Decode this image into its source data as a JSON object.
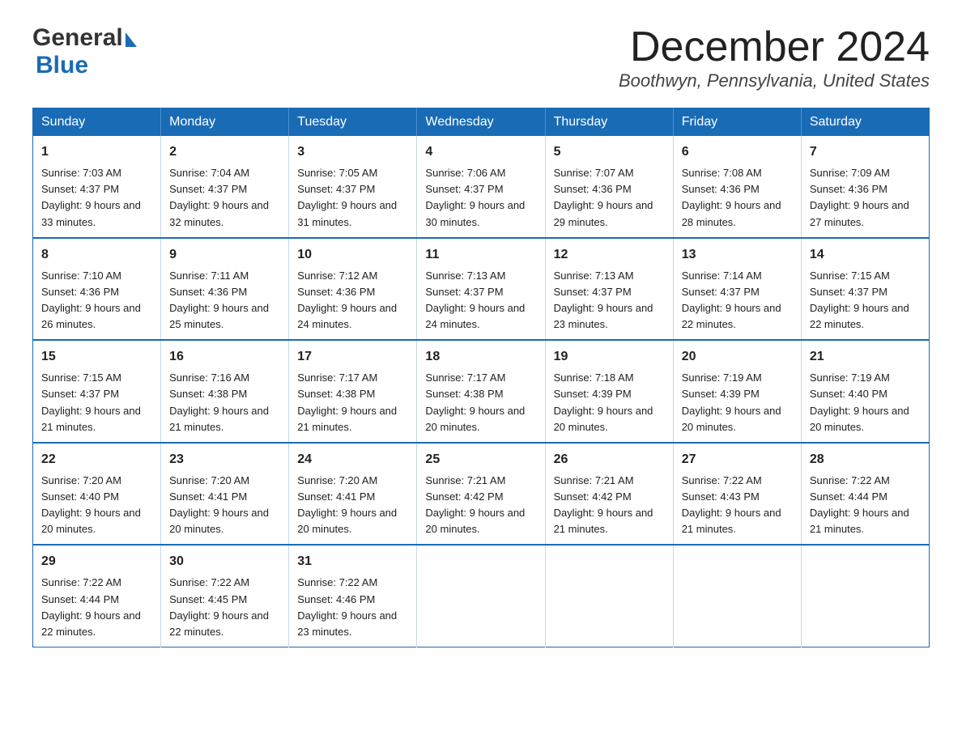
{
  "header": {
    "logo_general": "General",
    "logo_blue": "Blue",
    "month_title": "December 2024",
    "location": "Boothwyn, Pennsylvania, United States"
  },
  "days_of_week": [
    "Sunday",
    "Monday",
    "Tuesday",
    "Wednesday",
    "Thursday",
    "Friday",
    "Saturday"
  ],
  "weeks": [
    [
      {
        "day": "1",
        "sunrise": "7:03 AM",
        "sunset": "4:37 PM",
        "daylight": "9 hours and 33 minutes."
      },
      {
        "day": "2",
        "sunrise": "7:04 AM",
        "sunset": "4:37 PM",
        "daylight": "9 hours and 32 minutes."
      },
      {
        "day": "3",
        "sunrise": "7:05 AM",
        "sunset": "4:37 PM",
        "daylight": "9 hours and 31 minutes."
      },
      {
        "day": "4",
        "sunrise": "7:06 AM",
        "sunset": "4:37 PM",
        "daylight": "9 hours and 30 minutes."
      },
      {
        "day": "5",
        "sunrise": "7:07 AM",
        "sunset": "4:36 PM",
        "daylight": "9 hours and 29 minutes."
      },
      {
        "day": "6",
        "sunrise": "7:08 AM",
        "sunset": "4:36 PM",
        "daylight": "9 hours and 28 minutes."
      },
      {
        "day": "7",
        "sunrise": "7:09 AM",
        "sunset": "4:36 PM",
        "daylight": "9 hours and 27 minutes."
      }
    ],
    [
      {
        "day": "8",
        "sunrise": "7:10 AM",
        "sunset": "4:36 PM",
        "daylight": "9 hours and 26 minutes."
      },
      {
        "day": "9",
        "sunrise": "7:11 AM",
        "sunset": "4:36 PM",
        "daylight": "9 hours and 25 minutes."
      },
      {
        "day": "10",
        "sunrise": "7:12 AM",
        "sunset": "4:36 PM",
        "daylight": "9 hours and 24 minutes."
      },
      {
        "day": "11",
        "sunrise": "7:13 AM",
        "sunset": "4:37 PM",
        "daylight": "9 hours and 24 minutes."
      },
      {
        "day": "12",
        "sunrise": "7:13 AM",
        "sunset": "4:37 PM",
        "daylight": "9 hours and 23 minutes."
      },
      {
        "day": "13",
        "sunrise": "7:14 AM",
        "sunset": "4:37 PM",
        "daylight": "9 hours and 22 minutes."
      },
      {
        "day": "14",
        "sunrise": "7:15 AM",
        "sunset": "4:37 PM",
        "daylight": "9 hours and 22 minutes."
      }
    ],
    [
      {
        "day": "15",
        "sunrise": "7:15 AM",
        "sunset": "4:37 PM",
        "daylight": "9 hours and 21 minutes."
      },
      {
        "day": "16",
        "sunrise": "7:16 AM",
        "sunset": "4:38 PM",
        "daylight": "9 hours and 21 minutes."
      },
      {
        "day": "17",
        "sunrise": "7:17 AM",
        "sunset": "4:38 PM",
        "daylight": "9 hours and 21 minutes."
      },
      {
        "day": "18",
        "sunrise": "7:17 AM",
        "sunset": "4:38 PM",
        "daylight": "9 hours and 20 minutes."
      },
      {
        "day": "19",
        "sunrise": "7:18 AM",
        "sunset": "4:39 PM",
        "daylight": "9 hours and 20 minutes."
      },
      {
        "day": "20",
        "sunrise": "7:19 AM",
        "sunset": "4:39 PM",
        "daylight": "9 hours and 20 minutes."
      },
      {
        "day": "21",
        "sunrise": "7:19 AM",
        "sunset": "4:40 PM",
        "daylight": "9 hours and 20 minutes."
      }
    ],
    [
      {
        "day": "22",
        "sunrise": "7:20 AM",
        "sunset": "4:40 PM",
        "daylight": "9 hours and 20 minutes."
      },
      {
        "day": "23",
        "sunrise": "7:20 AM",
        "sunset": "4:41 PM",
        "daylight": "9 hours and 20 minutes."
      },
      {
        "day": "24",
        "sunrise": "7:20 AM",
        "sunset": "4:41 PM",
        "daylight": "9 hours and 20 minutes."
      },
      {
        "day": "25",
        "sunrise": "7:21 AM",
        "sunset": "4:42 PM",
        "daylight": "9 hours and 20 minutes."
      },
      {
        "day": "26",
        "sunrise": "7:21 AM",
        "sunset": "4:42 PM",
        "daylight": "9 hours and 21 minutes."
      },
      {
        "day": "27",
        "sunrise": "7:22 AM",
        "sunset": "4:43 PM",
        "daylight": "9 hours and 21 minutes."
      },
      {
        "day": "28",
        "sunrise": "7:22 AM",
        "sunset": "4:44 PM",
        "daylight": "9 hours and 21 minutes."
      }
    ],
    [
      {
        "day": "29",
        "sunrise": "7:22 AM",
        "sunset": "4:44 PM",
        "daylight": "9 hours and 22 minutes."
      },
      {
        "day": "30",
        "sunrise": "7:22 AM",
        "sunset": "4:45 PM",
        "daylight": "9 hours and 22 minutes."
      },
      {
        "day": "31",
        "sunrise": "7:22 AM",
        "sunset": "4:46 PM",
        "daylight": "9 hours and 23 minutes."
      },
      null,
      null,
      null,
      null
    ]
  ]
}
